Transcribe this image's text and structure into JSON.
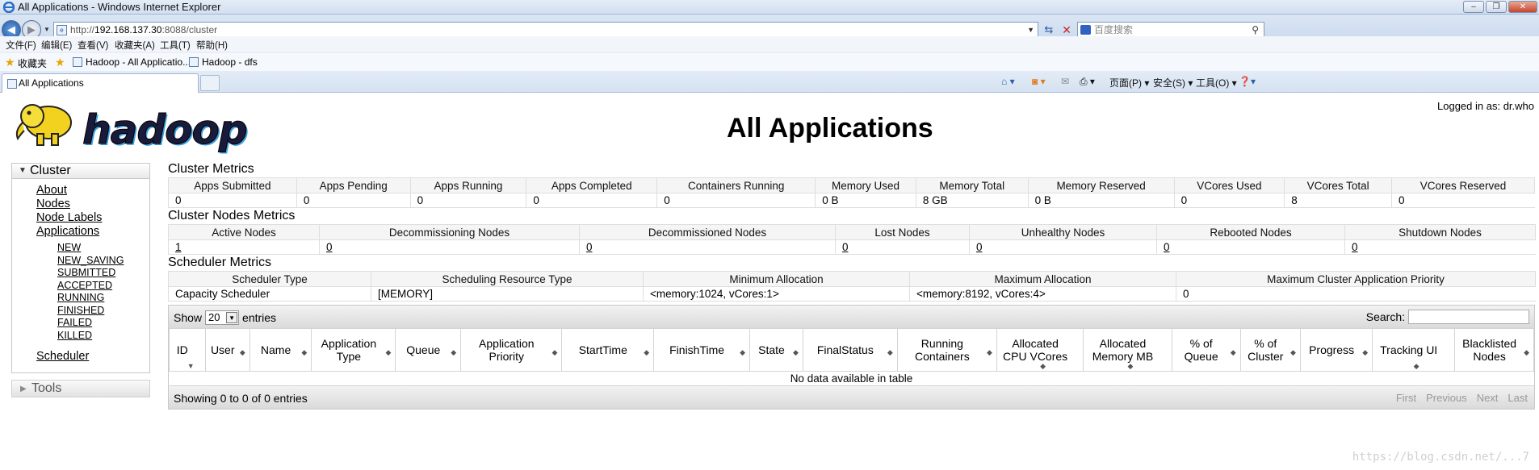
{
  "window": {
    "title": "All Applications - Windows Internet Explorer"
  },
  "address": {
    "url_prefix": "http://",
    "url_host": "192.168.137.30",
    "url_rest": ":8088/cluster",
    "search_placeholder": "百度搜索"
  },
  "menu": [
    "文件(F)",
    "编辑(E)",
    "查看(V)",
    "收藏夹(A)",
    "工具(T)",
    "帮助(H)"
  ],
  "favorites": {
    "label": "收藏夹",
    "items": [
      "Hadoop - All Applicatio...",
      "Hadoop - dfs"
    ]
  },
  "tab": {
    "label": "All Applications"
  },
  "commands": [
    "页面(P)",
    "安全(S)",
    "工具(O)"
  ],
  "page": {
    "logged_in": "Logged in as: dr.who",
    "logo_text": "hadoop",
    "title": "All Applications"
  },
  "sidebar": {
    "cluster_label": "Cluster",
    "links": [
      "About",
      "Nodes",
      "Node Labels",
      "Applications"
    ],
    "states": [
      "NEW",
      "NEW_SAVING",
      "SUBMITTED",
      "ACCEPTED",
      "RUNNING",
      "FINISHED",
      "FAILED",
      "KILLED"
    ],
    "scheduler": "Scheduler",
    "tools_label": "Tools"
  },
  "cluster_metrics": {
    "title": "Cluster Metrics",
    "headers": [
      "Apps Submitted",
      "Apps Pending",
      "Apps Running",
      "Apps Completed",
      "Containers Running",
      "Memory Used",
      "Memory Total",
      "Memory Reserved",
      "VCores Used",
      "VCores Total",
      "VCores Reserved"
    ],
    "values": [
      "0",
      "0",
      "0",
      "0",
      "0",
      "0 B",
      "8 GB",
      "0 B",
      "0",
      "8",
      "0"
    ]
  },
  "node_metrics": {
    "title": "Cluster Nodes Metrics",
    "headers": [
      "Active Nodes",
      "Decommissioning Nodes",
      "Decommissioned Nodes",
      "Lost Nodes",
      "Unhealthy Nodes",
      "Rebooted Nodes",
      "Shutdown Nodes"
    ],
    "values": [
      "1",
      "0",
      "0",
      "0",
      "0",
      "0",
      "0"
    ]
  },
  "scheduler_metrics": {
    "title": "Scheduler Metrics",
    "headers": [
      "Scheduler Type",
      "Scheduling Resource Type",
      "Minimum Allocation",
      "Maximum Allocation",
      "Maximum Cluster Application Priority"
    ],
    "values": [
      "Capacity Scheduler",
      "[MEMORY]",
      "<memory:1024, vCores:1>",
      "<memory:8192, vCores:4>",
      "0"
    ]
  },
  "apps_table": {
    "show_label": "Show",
    "entries_value": "20",
    "entries_label": "entries",
    "search_label": "Search:",
    "columns": [
      "ID",
      "User",
      "Name",
      "Application Type",
      "Queue",
      "Application Priority",
      "StartTime",
      "FinishTime",
      "State",
      "FinalStatus",
      "Running Containers",
      "Allocated CPU VCores",
      "Allocated Memory MB",
      "% of Queue",
      "% of Cluster",
      "Progress",
      "Tracking UI",
      "Blacklisted Nodes"
    ],
    "empty_message": "No data available in table",
    "info": "Showing 0 to 0 of 0 entries",
    "pager": [
      "First",
      "Previous",
      "Next",
      "Last"
    ]
  },
  "watermark": "https://blog.csdn.net/...7"
}
